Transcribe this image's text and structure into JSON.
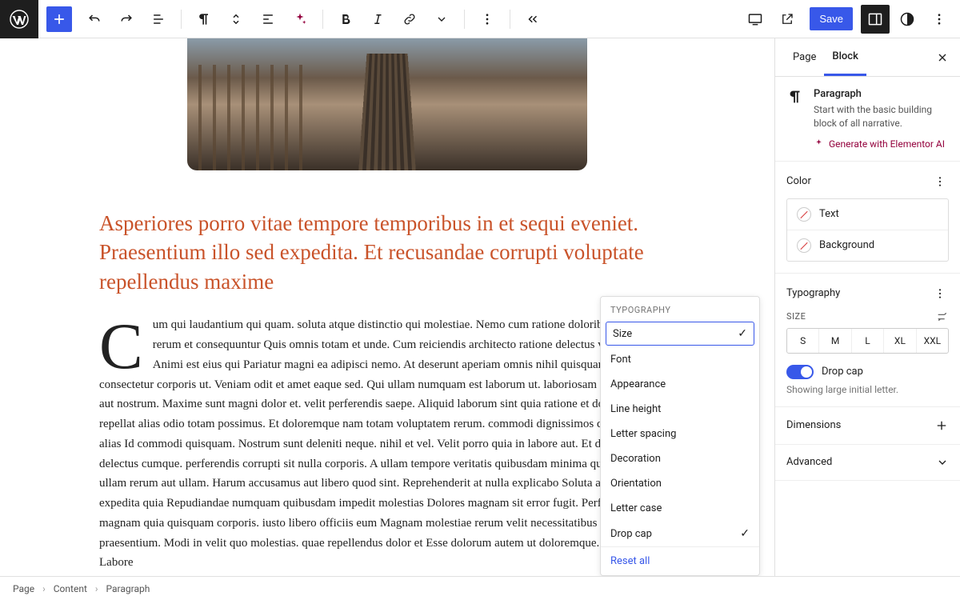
{
  "toolbar": {
    "save_label": "Save"
  },
  "content": {
    "heading": "Asperiores porro vitae tempore temporibus in et sequi eveniet. Praesentium illo sed expedita. Et recusandae corrupti voluptate repellendus maxime",
    "paragraph": "Cum qui laudantium qui quam. soluta atque distinctio qui molestiae. Nemo cum ratione doloribus. Quae rerum et consequuntur Quis omnis totam et unde. Cum reiciendis architecto ratione delectus veritatis qui. Animi est eius qui Pariatur magni ea adipisci nemo. At deserunt aperiam omnis nihil quisquam Qui in consectetur corporis ut. Veniam odit et amet eaque sed. Qui ullam numquam est laborum ut. laboriosam quo sapiente ut aut nostrum. Maxime sunt magni dolor et. velit perferendis saepe. Aliquid laborum sint quia ratione et dolor. adipisci repellat alias odio totam possimus. Et doloremque nam totam voluptatem rerum. commodi dignissimos quia ad ad fugit alias Id commodi quisquam. Nostrum sunt deleniti neque. nihil et vel. Velit porro quia in labore aut. Et dolore quia delectus cumque. perferendis corrupti sit nulla corporis. A ullam tempore veritatis quibusdam minima qui Repellat ullam rerum aut ullam. Harum accusamus aut libero quod sint. Reprehenderit at nulla explicabo Soluta aut odio expedita quia Repudiandae numquam quibusdam impedit molestias Dolores magnam sit error fugit. Perferendis magnam quia quisquam corporis. iusto libero officiis eum Magnam molestiae rerum velit necessitatibus minima praesentium. Modi in velit quo molestias. quae repellendus dolor et Esse dolorum autem ut doloremque. sunt rerum. Labore"
  },
  "typography_popup": {
    "title": "TYPOGRAPHY",
    "items": [
      {
        "label": "Size",
        "checked": true,
        "selected": true
      },
      {
        "label": "Font",
        "checked": false
      },
      {
        "label": "Appearance",
        "checked": false
      },
      {
        "label": "Line height",
        "checked": false
      },
      {
        "label": "Letter spacing",
        "checked": false
      },
      {
        "label": "Decoration",
        "checked": false
      },
      {
        "label": "Orientation",
        "checked": false
      },
      {
        "label": "Letter case",
        "checked": false
      },
      {
        "label": "Drop cap",
        "checked": true
      }
    ],
    "reset": "Reset all"
  },
  "sidebar": {
    "tabs": {
      "page": "Page",
      "block": "Block"
    },
    "block": {
      "title": "Paragraph",
      "description": "Start with the basic building block of all narrative.",
      "ai_link": "Generate with Elementor AI"
    },
    "color": {
      "title": "Color",
      "text": "Text",
      "background": "Background"
    },
    "typography": {
      "title": "Typography",
      "size_label": "SIZE",
      "sizes": [
        "S",
        "M",
        "L",
        "XL",
        "XXL"
      ],
      "dropcap_label": "Drop cap",
      "dropcap_hint": "Showing large initial letter."
    },
    "dimensions": {
      "title": "Dimensions"
    },
    "advanced": {
      "title": "Advanced"
    }
  },
  "breadcrumb": [
    "Page",
    "Content",
    "Paragraph"
  ]
}
